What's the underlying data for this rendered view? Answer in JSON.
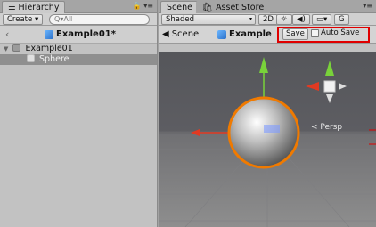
{
  "hierarchy": {
    "tab_label": "Hierarchy",
    "create_label": "Create",
    "search_placeholder": "Q▾All",
    "prefab_title": "Example01*",
    "items": [
      {
        "label": "Example01"
      },
      {
        "label": "Sphere"
      }
    ]
  },
  "scene": {
    "tabs": [
      {
        "label": "Scene"
      },
      {
        "label": "Asset Store"
      }
    ],
    "shading_mode": "Shaded",
    "mode_2d": "2D",
    "gizmos_label": "G",
    "breadcrumb_scene": "Scene",
    "breadcrumb_prefab": "Example",
    "save_label": "Save",
    "autosave_label": "Auto Save",
    "autosave_checked": false,
    "projection_label": "< Persp"
  },
  "colors": {
    "highlight": "#e00000",
    "selection_outline": "#f07a00",
    "axis_x": "#e23a22",
    "axis_y": "#79d23a",
    "axis_z": "#3a7fe2"
  },
  "icons": {
    "back": "chevron-left-icon",
    "prefab": "prefab-cube-icon",
    "lock": "lock-icon",
    "menu": "menu-icon",
    "light": "light-icon",
    "audio": "audio-icon",
    "image": "image-icon"
  }
}
